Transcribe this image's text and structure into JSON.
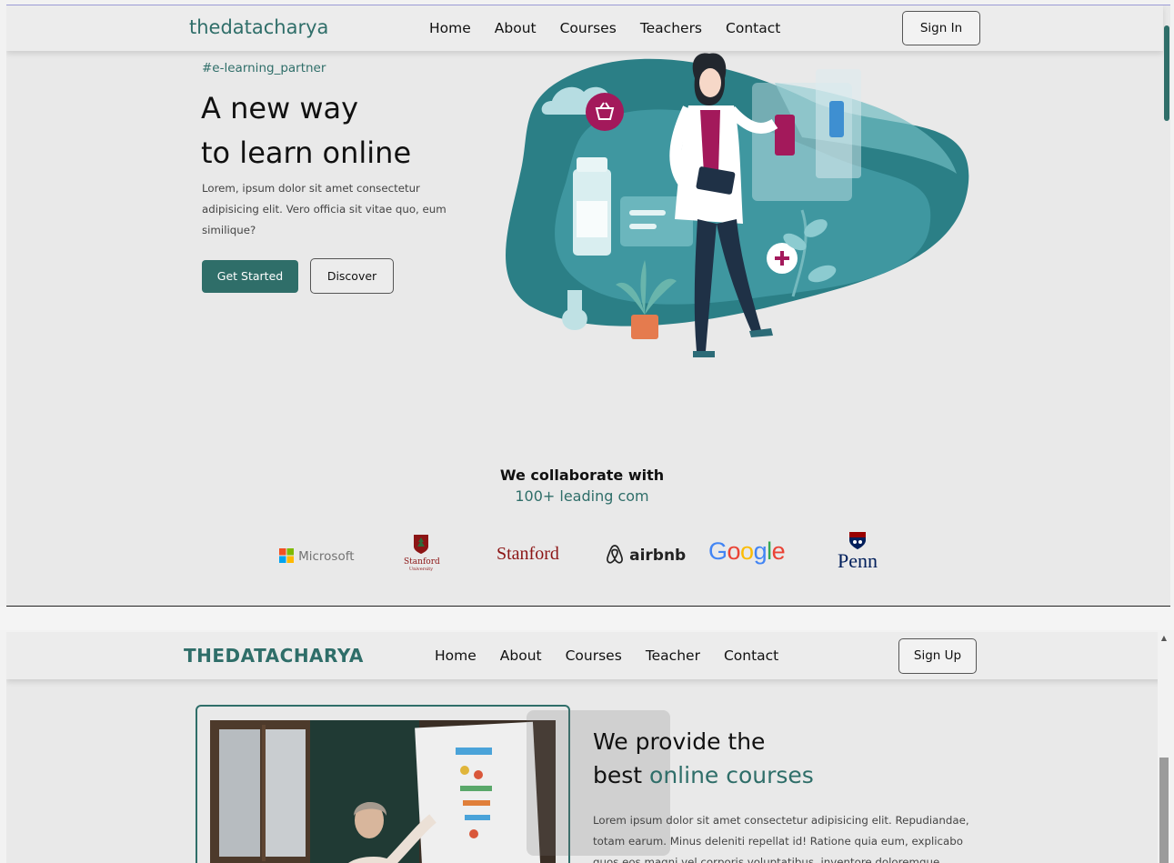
{
  "top_page": {
    "nav": {
      "logo": "thedatacharya",
      "links": [
        "Home",
        "About",
        "Courses",
        "Teachers",
        "Contact"
      ],
      "signin_label": "Sign In"
    },
    "hero": {
      "tag": "#e-learning_partner",
      "title_line1": "A new way",
      "title_line2": "to learn online",
      "description": "Lorem, ipsum dolor sit amet consectetur adipisicing elit. Vero officia sit vitae quo, eum similique?",
      "primary_button": "Get Started",
      "secondary_button": "Discover"
    },
    "collab": {
      "title": "We collaborate with",
      "subtitle": "100+ leading com"
    },
    "partners": {
      "microsoft": "Microsoft",
      "stanford_seal_line1": "Stanford",
      "stanford_seal_line2": "University",
      "stanford_wordmark": "Stanford",
      "airbnb": "airbnb",
      "google": "Google",
      "penn": "Penn"
    }
  },
  "bottom_page": {
    "nav": {
      "logo": "THEDATACHARYA",
      "links": [
        "Home",
        "About",
        "Courses",
        "Teacher",
        "Contact"
      ],
      "signup_label": "Sign Up"
    },
    "section": {
      "title_line1": "We provide the",
      "title_line2_plain": "best ",
      "title_line2_accent": "online courses",
      "description": "Lorem ipsum dolor sit amet consectetur adipisicing elit. Repudiandae, totam earum. Minus deleniti repellat id! Ratione quia eum, explicabo quos eos magni vel corporis voluptatibus, inventore doloremque."
    }
  },
  "colors": {
    "brand_teal": "#2f6e69",
    "accent_magenta": "#a3195b",
    "background": "#e9e9e9"
  },
  "icons": [
    "basket-icon",
    "plus-icon",
    "microsoft-logo-icon",
    "airbnb-logo-icon",
    "penn-shield-icon",
    "scroll-up-arrow-icon"
  ]
}
